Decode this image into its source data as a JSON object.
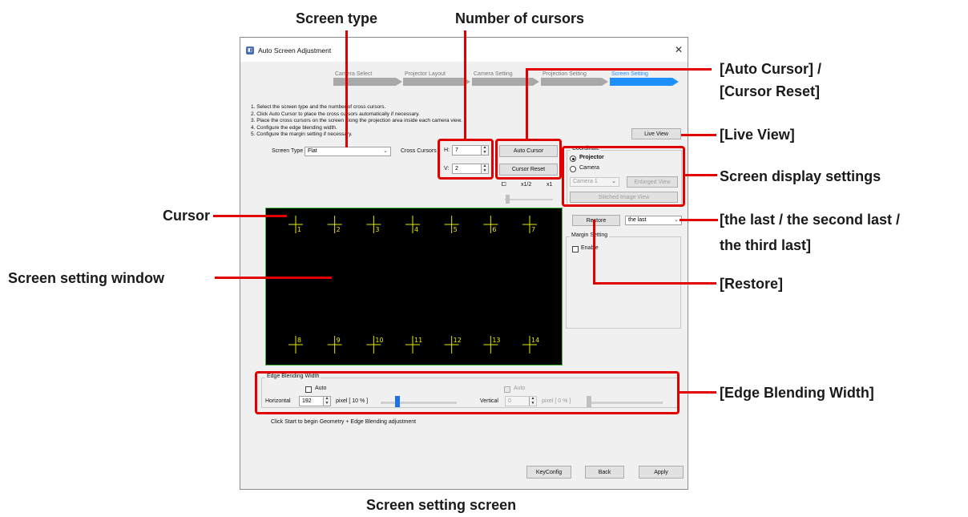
{
  "window": {
    "title": "Auto Screen Adjustment",
    "close_glyph": "✕",
    "app_icon_glyph": "◧"
  },
  "steps": [
    {
      "label": "Camera Select"
    },
    {
      "label": "Projector Layout"
    },
    {
      "label": "Camera Setting"
    },
    {
      "label": "Projection Setting"
    },
    {
      "label": "Screen Setting",
      "active": true
    }
  ],
  "instructions": [
    "1. Select the screen type and the number of cross cursors.",
    "2. Click Auto Cursor to place the cross cursors automatically if necessary.",
    "3. Place the cross cursors on the screen along the projection area inside each camera view.",
    "4. Configure the edge blending width.",
    "5. Configure the margin setting if necessary."
  ],
  "screen_type": {
    "label": "Screen Type",
    "value": "Flat"
  },
  "cross_cursors": {
    "label": "Cross Cursors",
    "h_label": "H:",
    "h_value": "7",
    "v_label": "V:",
    "v_value": "2"
  },
  "buttons": {
    "auto_cursor": "Auto Cursor",
    "cursor_reset": "Cursor Reset",
    "live_view": "Live View",
    "enlarged_view": "Enlarged View",
    "stitched_image_view": "Stitched Image View",
    "restore": "Restore",
    "keyconfig": "KeyConfig",
    "back": "Back",
    "apply": "Apply"
  },
  "coordinate": {
    "title": "Coordinate",
    "projector": "Projector",
    "camera": "Camera",
    "selected": "Projector",
    "camera_select": "Camera 1"
  },
  "zoom": {
    "fit_glyph": "⧠",
    "half": "x1/2",
    "one": "x1"
  },
  "restore_select": "the last",
  "margin": {
    "title": "Margin Setting",
    "enable": "Enable"
  },
  "cursors_top": [
    "1",
    "2",
    "3",
    "4",
    "5",
    "6",
    "7"
  ],
  "cursors_bottom": [
    "8",
    "9",
    "10",
    "11",
    "12",
    "13",
    "14"
  ],
  "edge_blending": {
    "title": "Edge Blending Width",
    "auto": "Auto",
    "horizontal_label": "Horizontal",
    "horizontal_value": "192",
    "horizontal_pixel": "pixel [ 10 % ]",
    "horizontal_slider_fraction": 0.2,
    "vertical_label": "Vertical",
    "vertical_value": "0",
    "vertical_pixel": "pixel [ 0 % ]",
    "vertical_slider_fraction": 0.0
  },
  "status_text": "Click Start to begin Geometry + Edge Blending adjustment",
  "callouts": {
    "screen_type": "Screen type",
    "number_of_cursors": "Number of cursors",
    "auto_cursor_1": "[Auto Cursor] /",
    "auto_cursor_2": "[Cursor Reset]",
    "live_view": "[Live View]",
    "screen_display": "Screen display settings",
    "the_last_1": "[the last / the second last /",
    "the_last_2": "the third last]",
    "restore": "[Restore]",
    "edge_blending": "[Edge Blending Width]",
    "cursor": "Cursor",
    "screen_setting_window": "Screen setting window"
  },
  "caption": "Screen setting screen",
  "colors": {
    "accent": "#1e90ff",
    "callout_red": "#e00000",
    "cursor_yellow": "#e8e800",
    "screen_border": "#3cb43c"
  }
}
